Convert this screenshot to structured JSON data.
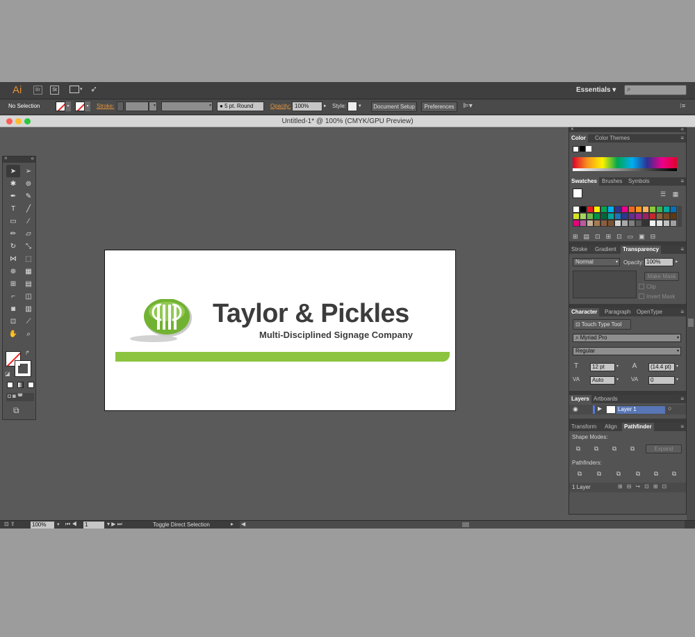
{
  "app": {
    "logo": "Ai",
    "bridge_label": "Br",
    "stock_label": "St",
    "workspace": "Essentials ▾",
    "search_placeholder": ""
  },
  "control_bar": {
    "selection": "No Selection",
    "stroke_label": "Stroke:",
    "brush": "5 pt. Round",
    "opacity_label": "Opacity:",
    "opacity_value": "100%",
    "style_label": "Style:",
    "document_setup": "Document Setup",
    "preferences": "Preferences"
  },
  "document": {
    "title": "Untitled-1* @ 100% (CMYK/GPU Preview)"
  },
  "artwork": {
    "logo_title": "Taylor & Pickles",
    "logo_tagline": "Multi-Disciplined Signage Company",
    "logo_color": "#8cc440",
    "text_color": "#3c3c3c"
  },
  "panels": {
    "color": {
      "tabs": [
        "Color",
        "Color Themes"
      ]
    },
    "swatches": {
      "tabs": [
        "Swatches",
        "Brushes",
        "Symbols"
      ]
    },
    "transparency": {
      "tabs": [
        "Stroke",
        "Gradient",
        "Transparency"
      ],
      "blend_mode": "Normal",
      "opacity_label": "Opacity:",
      "opacity_value": "100%",
      "make_mask": "Make Mask",
      "clip": "Clip",
      "invert_mask": "Invert Mask"
    },
    "character": {
      "tabs": [
        "Character",
        "Paragraph",
        "OpenType"
      ],
      "touch_type": "Touch Type Tool",
      "font": "Myriad Pro",
      "style": "Regular",
      "size": "12 pt",
      "leading": "(14.4 pt)",
      "kerning": "Auto",
      "tracking": "0"
    },
    "layers": {
      "tabs": [
        "Layers",
        "Artboards"
      ],
      "layer_name": "Layer 1",
      "count": "1 Layer"
    },
    "pathfinder": {
      "tabs": [
        "Transform",
        "Align",
        "Pathfinder"
      ],
      "shape_modes": "Shape Modes:",
      "expand": "Expand",
      "pathfinders": "Pathfinders:"
    }
  },
  "status_bar": {
    "zoom": "100%",
    "artboard": "1",
    "status": "Toggle Direct Selection"
  }
}
